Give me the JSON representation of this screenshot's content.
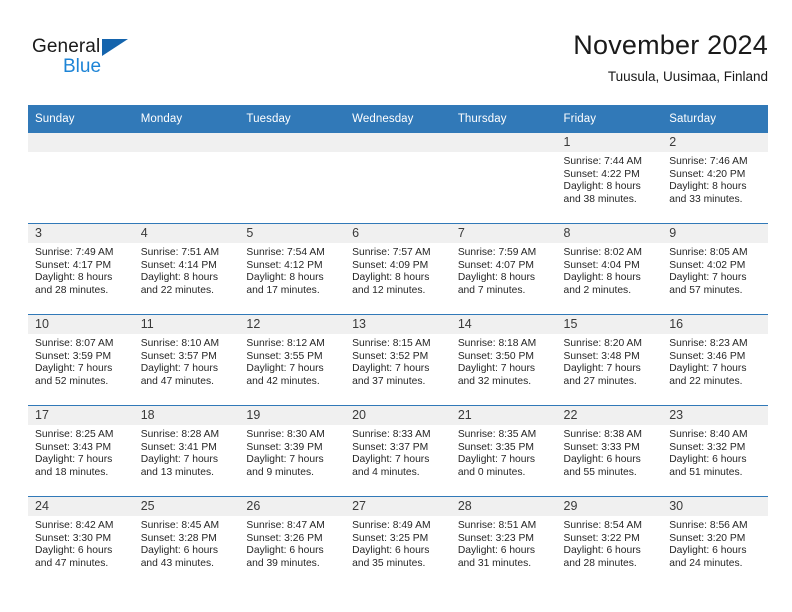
{
  "brand": {
    "name_part1": "General",
    "name_part2": "Blue",
    "triangle_color": "#1464ad",
    "blue_color": "#1d84d6"
  },
  "header": {
    "title": "November 2024",
    "location": "Tuusula, Uusimaa, Finland"
  },
  "theme": {
    "header_blue": "#3179b8",
    "daynum_band": "#f0f0f0",
    "text": "#262626"
  },
  "weekday_headers": [
    "Sunday",
    "Monday",
    "Tuesday",
    "Wednesday",
    "Thursday",
    "Friday",
    "Saturday"
  ],
  "weeks": [
    [
      {
        "day": "",
        "sunrise": "",
        "sunset": "",
        "daylight_line1": "",
        "daylight_line2": ""
      },
      {
        "day": "",
        "sunrise": "",
        "sunset": "",
        "daylight_line1": "",
        "daylight_line2": ""
      },
      {
        "day": "",
        "sunrise": "",
        "sunset": "",
        "daylight_line1": "",
        "daylight_line2": ""
      },
      {
        "day": "",
        "sunrise": "",
        "sunset": "",
        "daylight_line1": "",
        "daylight_line2": ""
      },
      {
        "day": "",
        "sunrise": "",
        "sunset": "",
        "daylight_line1": "",
        "daylight_line2": ""
      },
      {
        "day": "1",
        "sunrise": "Sunrise: 7:44 AM",
        "sunset": "Sunset: 4:22 PM",
        "daylight_line1": "Daylight: 8 hours",
        "daylight_line2": "and 38 minutes."
      },
      {
        "day": "2",
        "sunrise": "Sunrise: 7:46 AM",
        "sunset": "Sunset: 4:20 PM",
        "daylight_line1": "Daylight: 8 hours",
        "daylight_line2": "and 33 minutes."
      }
    ],
    [
      {
        "day": "3",
        "sunrise": "Sunrise: 7:49 AM",
        "sunset": "Sunset: 4:17 PM",
        "daylight_line1": "Daylight: 8 hours",
        "daylight_line2": "and 28 minutes."
      },
      {
        "day": "4",
        "sunrise": "Sunrise: 7:51 AM",
        "sunset": "Sunset: 4:14 PM",
        "daylight_line1": "Daylight: 8 hours",
        "daylight_line2": "and 22 minutes."
      },
      {
        "day": "5",
        "sunrise": "Sunrise: 7:54 AM",
        "sunset": "Sunset: 4:12 PM",
        "daylight_line1": "Daylight: 8 hours",
        "daylight_line2": "and 17 minutes."
      },
      {
        "day": "6",
        "sunrise": "Sunrise: 7:57 AM",
        "sunset": "Sunset: 4:09 PM",
        "daylight_line1": "Daylight: 8 hours",
        "daylight_line2": "and 12 minutes."
      },
      {
        "day": "7",
        "sunrise": "Sunrise: 7:59 AM",
        "sunset": "Sunset: 4:07 PM",
        "daylight_line1": "Daylight: 8 hours",
        "daylight_line2": "and 7 minutes."
      },
      {
        "day": "8",
        "sunrise": "Sunrise: 8:02 AM",
        "sunset": "Sunset: 4:04 PM",
        "daylight_line1": "Daylight: 8 hours",
        "daylight_line2": "and 2 minutes."
      },
      {
        "day": "9",
        "sunrise": "Sunrise: 8:05 AM",
        "sunset": "Sunset: 4:02 PM",
        "daylight_line1": "Daylight: 7 hours",
        "daylight_line2": "and 57 minutes."
      }
    ],
    [
      {
        "day": "10",
        "sunrise": "Sunrise: 8:07 AM",
        "sunset": "Sunset: 3:59 PM",
        "daylight_line1": "Daylight: 7 hours",
        "daylight_line2": "and 52 minutes."
      },
      {
        "day": "11",
        "sunrise": "Sunrise: 8:10 AM",
        "sunset": "Sunset: 3:57 PM",
        "daylight_line1": "Daylight: 7 hours",
        "daylight_line2": "and 47 minutes."
      },
      {
        "day": "12",
        "sunrise": "Sunrise: 8:12 AM",
        "sunset": "Sunset: 3:55 PM",
        "daylight_line1": "Daylight: 7 hours",
        "daylight_line2": "and 42 minutes."
      },
      {
        "day": "13",
        "sunrise": "Sunrise: 8:15 AM",
        "sunset": "Sunset: 3:52 PM",
        "daylight_line1": "Daylight: 7 hours",
        "daylight_line2": "and 37 minutes."
      },
      {
        "day": "14",
        "sunrise": "Sunrise: 8:18 AM",
        "sunset": "Sunset: 3:50 PM",
        "daylight_line1": "Daylight: 7 hours",
        "daylight_line2": "and 32 minutes."
      },
      {
        "day": "15",
        "sunrise": "Sunrise: 8:20 AM",
        "sunset": "Sunset: 3:48 PM",
        "daylight_line1": "Daylight: 7 hours",
        "daylight_line2": "and 27 minutes."
      },
      {
        "day": "16",
        "sunrise": "Sunrise: 8:23 AM",
        "sunset": "Sunset: 3:46 PM",
        "daylight_line1": "Daylight: 7 hours",
        "daylight_line2": "and 22 minutes."
      }
    ],
    [
      {
        "day": "17",
        "sunrise": "Sunrise: 8:25 AM",
        "sunset": "Sunset: 3:43 PM",
        "daylight_line1": "Daylight: 7 hours",
        "daylight_line2": "and 18 minutes."
      },
      {
        "day": "18",
        "sunrise": "Sunrise: 8:28 AM",
        "sunset": "Sunset: 3:41 PM",
        "daylight_line1": "Daylight: 7 hours",
        "daylight_line2": "and 13 minutes."
      },
      {
        "day": "19",
        "sunrise": "Sunrise: 8:30 AM",
        "sunset": "Sunset: 3:39 PM",
        "daylight_line1": "Daylight: 7 hours",
        "daylight_line2": "and 9 minutes."
      },
      {
        "day": "20",
        "sunrise": "Sunrise: 8:33 AM",
        "sunset": "Sunset: 3:37 PM",
        "daylight_line1": "Daylight: 7 hours",
        "daylight_line2": "and 4 minutes."
      },
      {
        "day": "21",
        "sunrise": "Sunrise: 8:35 AM",
        "sunset": "Sunset: 3:35 PM",
        "daylight_line1": "Daylight: 7 hours",
        "daylight_line2": "and 0 minutes."
      },
      {
        "day": "22",
        "sunrise": "Sunrise: 8:38 AM",
        "sunset": "Sunset: 3:33 PM",
        "daylight_line1": "Daylight: 6 hours",
        "daylight_line2": "and 55 minutes."
      },
      {
        "day": "23",
        "sunrise": "Sunrise: 8:40 AM",
        "sunset": "Sunset: 3:32 PM",
        "daylight_line1": "Daylight: 6 hours",
        "daylight_line2": "and 51 minutes."
      }
    ],
    [
      {
        "day": "24",
        "sunrise": "Sunrise: 8:42 AM",
        "sunset": "Sunset: 3:30 PM",
        "daylight_line1": "Daylight: 6 hours",
        "daylight_line2": "and 47 minutes."
      },
      {
        "day": "25",
        "sunrise": "Sunrise: 8:45 AM",
        "sunset": "Sunset: 3:28 PM",
        "daylight_line1": "Daylight: 6 hours",
        "daylight_line2": "and 43 minutes."
      },
      {
        "day": "26",
        "sunrise": "Sunrise: 8:47 AM",
        "sunset": "Sunset: 3:26 PM",
        "daylight_line1": "Daylight: 6 hours",
        "daylight_line2": "and 39 minutes."
      },
      {
        "day": "27",
        "sunrise": "Sunrise: 8:49 AM",
        "sunset": "Sunset: 3:25 PM",
        "daylight_line1": "Daylight: 6 hours",
        "daylight_line2": "and 35 minutes."
      },
      {
        "day": "28",
        "sunrise": "Sunrise: 8:51 AM",
        "sunset": "Sunset: 3:23 PM",
        "daylight_line1": "Daylight: 6 hours",
        "daylight_line2": "and 31 minutes."
      },
      {
        "day": "29",
        "sunrise": "Sunrise: 8:54 AM",
        "sunset": "Sunset: 3:22 PM",
        "daylight_line1": "Daylight: 6 hours",
        "daylight_line2": "and 28 minutes."
      },
      {
        "day": "30",
        "sunrise": "Sunrise: 8:56 AM",
        "sunset": "Sunset: 3:20 PM",
        "daylight_line1": "Daylight: 6 hours",
        "daylight_line2": "and 24 minutes."
      }
    ]
  ]
}
